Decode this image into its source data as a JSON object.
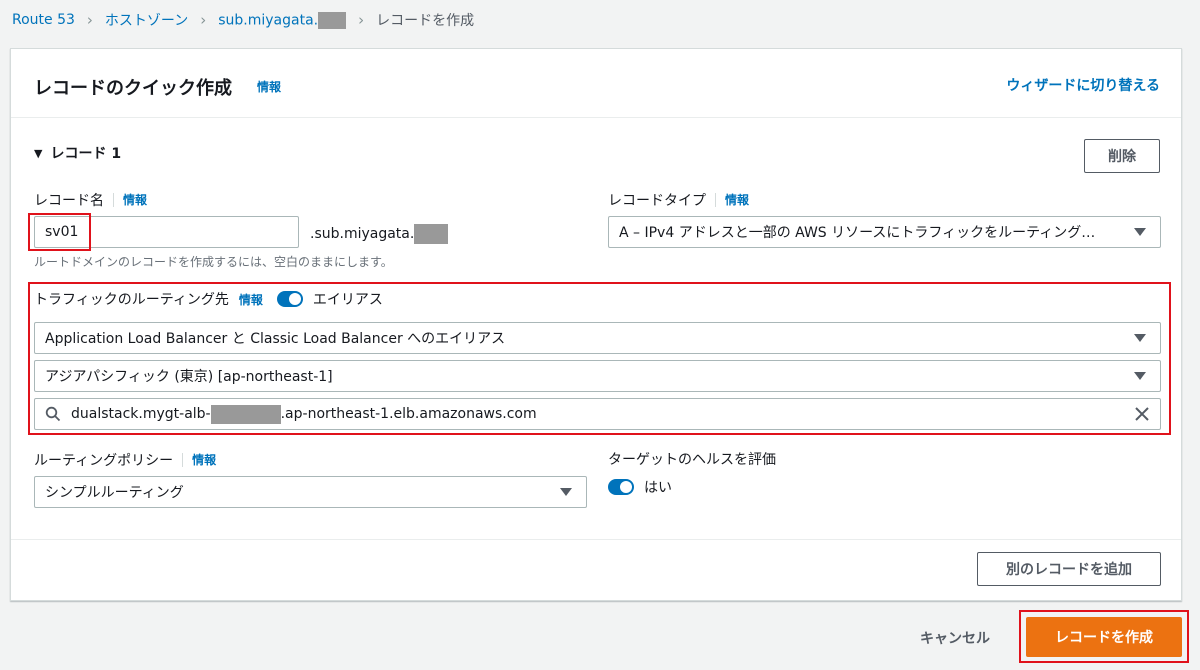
{
  "breadcrumb": {
    "items": [
      "Route 53",
      "ホストゾーン",
      "sub.miyagata."
    ],
    "current": "レコードを作成"
  },
  "panel": {
    "title": "レコードのクイック作成",
    "title_info": "情報",
    "wizard_link": "ウィザードに切り替える"
  },
  "record": {
    "section_title": "レコード 1",
    "delete_label": "削除",
    "name_label": "レコード名",
    "name_info": "情報",
    "name_value": "sv01",
    "domain_suffix": ".sub.miyagata.",
    "name_help": "ルートドメインのレコードを作成するには、空白のままにします。",
    "type_label": "レコードタイプ",
    "type_info": "情報",
    "type_value": "A – IPv4 アドレスと一部の AWS リソースにトラフィックをルーティング…",
    "routing_target_label": "トラフィックのルーティング先",
    "routing_target_info": "情報",
    "alias_label": "エイリアス",
    "alias_on": true,
    "endpoint_value": "Application Load Balancer と Classic Load Balancer へのエイリアス",
    "region_value": "アジアパシフィック (東京) [ap-northeast-1]",
    "lb_search_prefix": "dualstack.mygt-alb-",
    "lb_search_suffix": ".ap-northeast-1.elb.amazonaws.com",
    "policy_label": "ルーティングポリシー",
    "policy_info": "情報",
    "policy_value": "シンプルルーティング",
    "health_label": "ターゲットのヘルスを評価",
    "health_value": "はい",
    "health_on": true
  },
  "actions": {
    "add_record": "別のレコードを追加",
    "cancel": "キャンセル",
    "create": "レコードを作成"
  },
  "colors": {
    "accent": "#0073bb",
    "primary_button": "#ec7211",
    "highlight_frame": "#e0121b"
  }
}
